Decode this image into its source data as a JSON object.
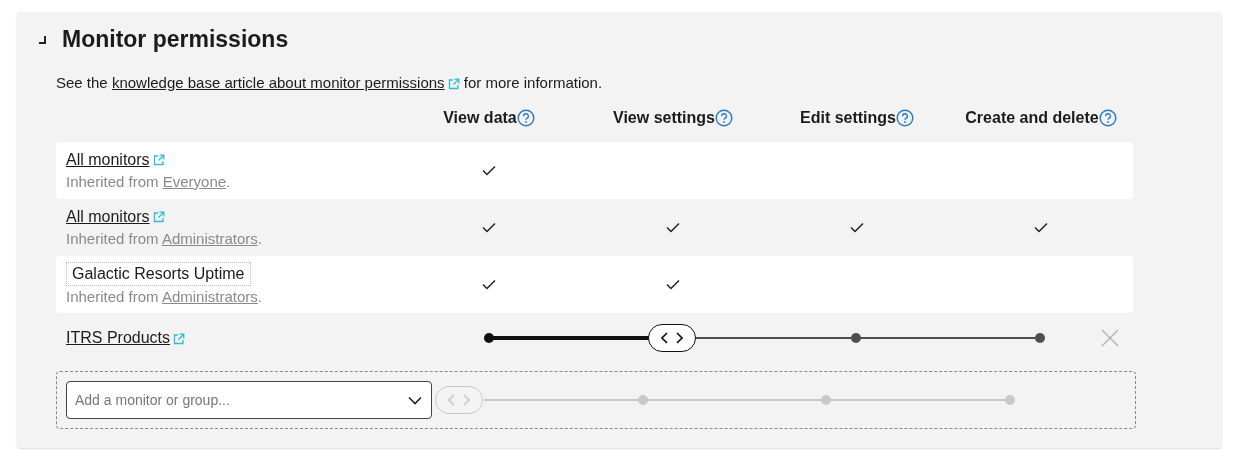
{
  "section": {
    "title": "Monitor permissions",
    "expanded": true
  },
  "intro": {
    "before": "See the ",
    "link": "knowledge base article about monitor permissions",
    "after": " for more information."
  },
  "columns": [
    {
      "label": "View data"
    },
    {
      "label": "View settings"
    },
    {
      "label": "Edit settings"
    },
    {
      "label": "Create and delete"
    }
  ],
  "rows": [
    {
      "kind": "link",
      "name": "All monitors",
      "inherited": {
        "before": "Inherited from ",
        "group": "Everyone",
        "after": "."
      },
      "permissions": [
        true,
        false,
        false,
        false
      ]
    },
    {
      "kind": "link",
      "name": "All monitors",
      "inherited": {
        "before": "Inherited from ",
        "group": "Administrators",
        "after": "."
      },
      "permissions": [
        true,
        true,
        true,
        true
      ]
    },
    {
      "kind": "plain",
      "name": "Galactic Resorts Uptime",
      "inherited": {
        "before": "Inherited from ",
        "group": "Administrators",
        "after": "."
      },
      "permissions": [
        true,
        true,
        false,
        false
      ]
    }
  ],
  "editable": {
    "name": "ITRS Products",
    "level": 0.333
  },
  "add_row": {
    "placeholder": "Add a monitor or group...",
    "level": 0,
    "disabled": true
  }
}
